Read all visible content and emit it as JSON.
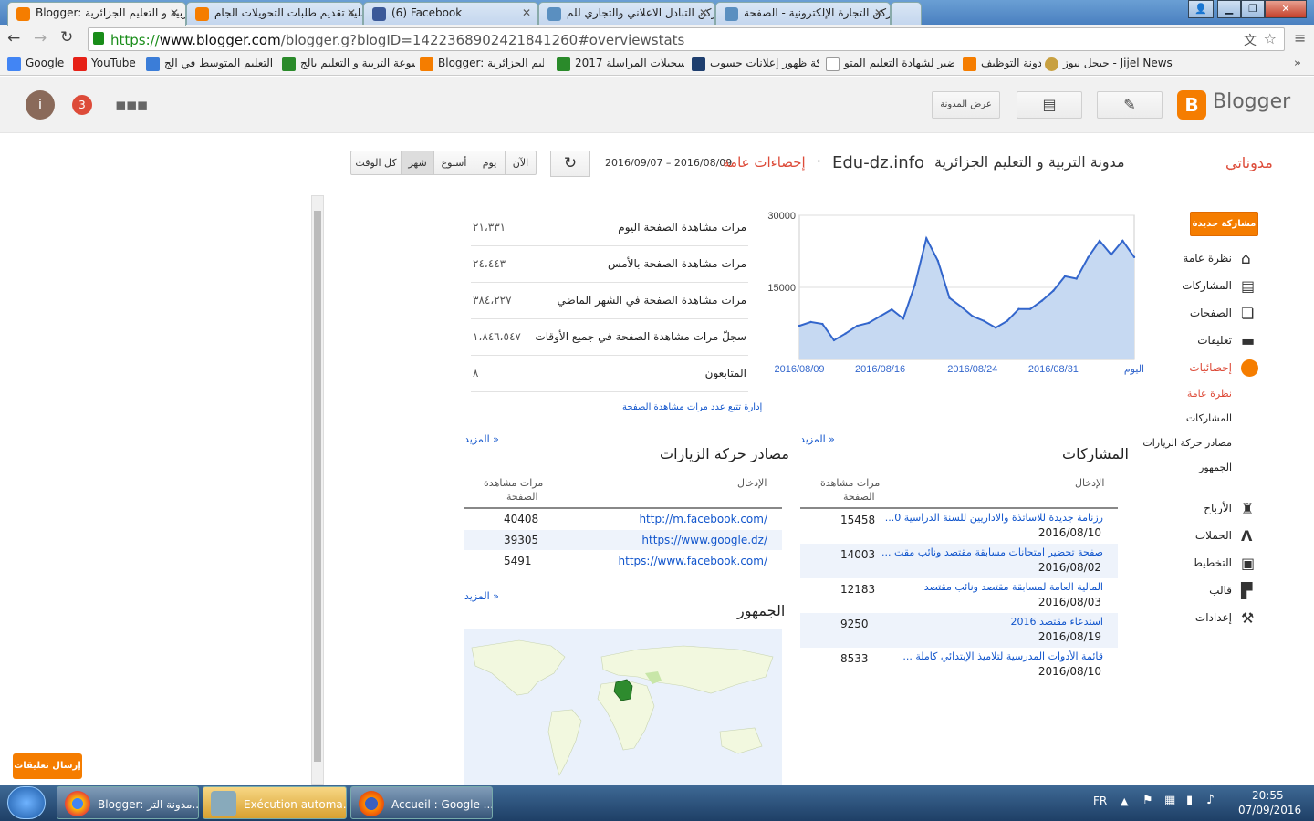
{
  "browser": {
    "tabs": [
      {
        "title": "Blogger: ربية و التعليم الجزائرية",
        "active": true
      },
      {
        "title": "عملية تقديم طلبات التحويلات الجام",
        "active": false
      },
      {
        "title": "(6) Facebook",
        "active": false
      },
      {
        "title": "ركن التبادل الاعلاني والتجاري للم",
        "active": false
      },
      {
        "title": "ركن التجارة الإلكترونية - الصفحة",
        "active": false
      }
    ],
    "url_scheme": "https://",
    "url_host": "www.blogger.com",
    "url_path": "/blogger.g?blogID=1422368902421841260#overviewstats",
    "bookmarks": [
      "Google",
      "YouTube",
      "مدونة التعليم المتوسط في الج",
      "موسوعة التربية و التعليم بالج",
      "Blogger: التعليم الجزائرية",
      "تسجيلات المراسلة 2017 dz",
      "شبكة ظهور إعلانات حسوب",
      "التحضير لشهادة التعليم المتو",
      "مدونة التوظيف",
      "جيجل نيوز - Jijel News"
    ]
  },
  "header": {
    "avatar_letter": "i",
    "notifications": "3",
    "view_blog": "عرض المدونة",
    "brand": "Blogger"
  },
  "stats_header": {
    "my_blogs": "مدوناتي",
    "blog_name": "مدونة التربية و التعليم الجزائرية",
    "blog_domain": "Edu-dz.info",
    "separator": "·",
    "section": "إحصاءات عامة",
    "date_range": "2016/09/07 – 2016/08/09",
    "ranges": [
      "كل الوقت",
      "شهر",
      "أسبوع",
      "يوم",
      "الآن"
    ],
    "active_range": "شهر"
  },
  "summary": {
    "rows": [
      {
        "label": "مرات مشاهدة الصفحة اليوم",
        "value": "٢١،٣٣١"
      },
      {
        "label": "مرات مشاهدة الصفحة بالأمس",
        "value": "٢٤،٤٤٣"
      },
      {
        "label": "مرات مشاهدة الصفحة في الشهر الماضي",
        "value": "٣٨٤،٢٢٧"
      },
      {
        "label": "سجلّ مرات مشاهدة الصفحة في جميع الأوقات",
        "value": "١،٨٤٦،٥٤٧"
      },
      {
        "label": "المتابعون",
        "value": "٨"
      }
    ],
    "manage_link": "إدارة تتبع عدد مرات مشاهدة الصفحة"
  },
  "chart_data": {
    "type": "area",
    "x": [
      "2016/08/09",
      "2016/08/10",
      "2016/08/11",
      "2016/08/12",
      "2016/08/13",
      "2016/08/14",
      "2016/08/15",
      "2016/08/16",
      "2016/08/17",
      "2016/08/18",
      "2016/08/19",
      "2016/08/20",
      "2016/08/21",
      "2016/08/22",
      "2016/08/23",
      "2016/08/24",
      "2016/08/25",
      "2016/08/26",
      "2016/08/27",
      "2016/08/28",
      "2016/08/29",
      "2016/08/30",
      "2016/08/31",
      "2016/09/01",
      "2016/09/02",
      "2016/09/03",
      "2016/09/04",
      "2016/09/05",
      "2016/09/06",
      "2016/09/07"
    ],
    "values": [
      7000,
      7800,
      7400,
      4000,
      5400,
      7000,
      7600,
      9000,
      10400,
      8500,
      15500,
      25200,
      20500,
      12800,
      11000,
      9000,
      8000,
      6600,
      8000,
      10500,
      10500,
      12200,
      14300,
      17300,
      16800,
      21200,
      24700,
      21800,
      24700,
      21300
    ],
    "ylim": [
      0,
      30000
    ],
    "yticks": [
      "30000",
      "15000"
    ],
    "xtick_labels": [
      "2016/08/09",
      "2016/08/16",
      "2016/08/24",
      "2016/08/31",
      "اليوم"
    ],
    "color": "#3366cc",
    "fill": "#c6d9f2",
    "grid": true
  },
  "posts": {
    "title": "المشاركات",
    "more": "المزيد »",
    "col_entry": "الإدخال",
    "col_views_1": "مرات مشاهدة",
    "col_views_2": "الصفحة",
    "rows": [
      {
        "title": "رزنامة جديدة للاساتذة والاداريين للسنة الدراسية 0...",
        "date": "2016/08/10",
        "views": "15458"
      },
      {
        "title": "صفحة تحضير امتحانات مسابقة مقتصد ونائب مقت ...",
        "date": "2016/08/02",
        "views": "14003"
      },
      {
        "title": "المالية العامة لمسابقة مقتصد ونائب مقتصد",
        "date": "2016/08/03",
        "views": "12183"
      },
      {
        "title": "استدعاء مقتصد 2016",
        "date": "2016/08/19",
        "views": "9250"
      },
      {
        "title": "قائمة الأدوات المدرسية لتلاميذ الإبتدائي كاملة ...",
        "date": "2016/08/10",
        "views": "8533"
      }
    ]
  },
  "traffic": {
    "title": "مصادر حركة الزيارات",
    "more": "المزيد »",
    "col_entry": "الإدخال",
    "col_views_1": "مرات مشاهدة",
    "col_views_2": "الصفحة",
    "rows": [
      {
        "source": "http://m.facebook.com/",
        "views": "40408"
      },
      {
        "source": "https://www.google.dz/",
        "views": "39305"
      },
      {
        "source": "https://www.facebook.com/",
        "views": "5491"
      }
    ]
  },
  "audience": {
    "title": "الجمهور",
    "more": "المزيد »"
  },
  "sidebar": {
    "new_post": "مشاركة جديدة",
    "items": [
      {
        "label": "نظرة عامة",
        "icon": "home-icon"
      },
      {
        "label": "المشاركات",
        "icon": "posts-icon"
      },
      {
        "label": "الصفحات",
        "icon": "pages-icon"
      },
      {
        "label": "تعليقات",
        "icon": "comments-icon"
      },
      {
        "label": "إحصائيات",
        "icon": "stats-icon"
      }
    ],
    "stats_sub": [
      "نظرة عامة",
      "المشاركات",
      "مصادر حركة الزيارات",
      "الجمهور"
    ],
    "items2": [
      {
        "label": "الأرباح",
        "icon": "trophy-icon"
      },
      {
        "label": "الحملات",
        "icon": "campaigns-icon"
      },
      {
        "label": "التخطيط",
        "icon": "layout-icon"
      },
      {
        "label": "قالب",
        "icon": "template-icon"
      },
      {
        "label": "إعدادات",
        "icon": "wrench-icon"
      }
    ]
  },
  "feedback": "إرسال تعليقات",
  "taskbar": {
    "tasks": [
      "Blogger: مدونة التر...",
      "Exécution automa...",
      "Accueil : Google ..."
    ],
    "lang": "FR",
    "time": "20:55",
    "date": "07/09/2016"
  },
  "colors": {
    "accent": "#dd4b39",
    "orange": "#f57d00",
    "link": "#1155cc"
  }
}
